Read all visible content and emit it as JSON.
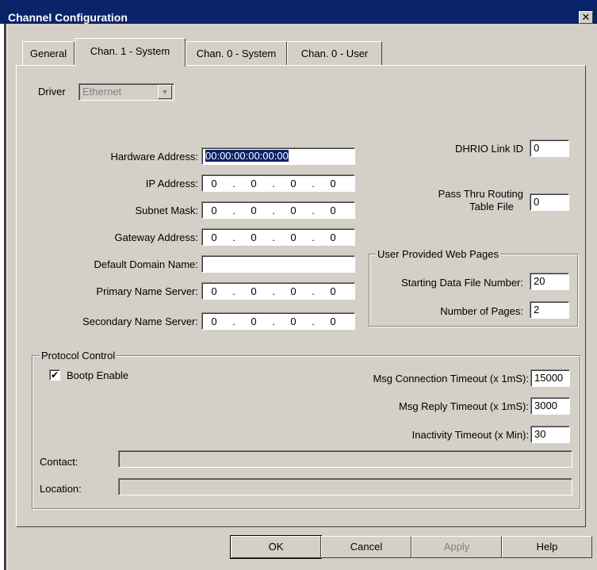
{
  "window": {
    "title": "Channel Configuration",
    "close_glyph": "✕"
  },
  "tabs": [
    {
      "label": "General",
      "active": false
    },
    {
      "label": "Chan. 1 - System",
      "active": true
    },
    {
      "label": "Chan. 0 - System",
      "active": false
    },
    {
      "label": "Chan. 0 - User",
      "active": false
    }
  ],
  "driver": {
    "label": "Driver",
    "value": "Ethernet",
    "arrow": "▼"
  },
  "network": {
    "hardware_address": {
      "label": "Hardware Address:",
      "value": "00:00:00:00:00:00"
    },
    "ip_address": {
      "label": "IP Address:",
      "octets": [
        "0",
        "0",
        "0",
        "0"
      ]
    },
    "subnet_mask": {
      "label": "Subnet Mask:",
      "octets": [
        "0",
        "0",
        "0",
        "0"
      ]
    },
    "gateway_address": {
      "label": "Gateway Address:",
      "octets": [
        "0",
        "0",
        "0",
        "0"
      ]
    },
    "default_domain_name": {
      "label": "Default Domain Name:",
      "value": ""
    },
    "primary_name_server": {
      "label": "Primary Name Server:",
      "octets": [
        "0",
        "0",
        "0",
        "0"
      ]
    },
    "secondary_name_server": {
      "label": "Secondary Name Server:",
      "octets": [
        "0",
        "0",
        "0",
        "0"
      ]
    },
    "dot": "."
  },
  "dhrio": {
    "label": "DHRIO Link ID",
    "value": "0"
  },
  "pass_thru": {
    "label_line1": "Pass Thru Routing",
    "label_line2": "Table File",
    "value": "0"
  },
  "web_pages": {
    "title": "User Provided Web Pages",
    "starting_file_label": "Starting Data File Number:",
    "starting_file_value": "20",
    "num_pages_label": "Number of Pages:",
    "num_pages_value": "2"
  },
  "protocol": {
    "title": "Protocol Control",
    "bootp_label": "Bootp Enable",
    "bootp_checked": "✔",
    "msg_conn_label": "Msg Connection Timeout (x 1mS):",
    "msg_conn_value": "15000",
    "msg_reply_label": "Msg Reply Timeout (x 1mS):",
    "msg_reply_value": "3000",
    "inactivity_label": "Inactivity Timeout (x Min):",
    "inactivity_value": "30",
    "contact_label": "Contact:",
    "contact_value": "",
    "location_label": "Location:",
    "location_value": ""
  },
  "buttons": {
    "ok": "OK",
    "cancel": "Cancel",
    "apply": "Apply",
    "help": "Help"
  },
  "colors": {
    "title_bar": "#0a246a",
    "face": "#d4d0c8",
    "selection": "#0a246a"
  }
}
